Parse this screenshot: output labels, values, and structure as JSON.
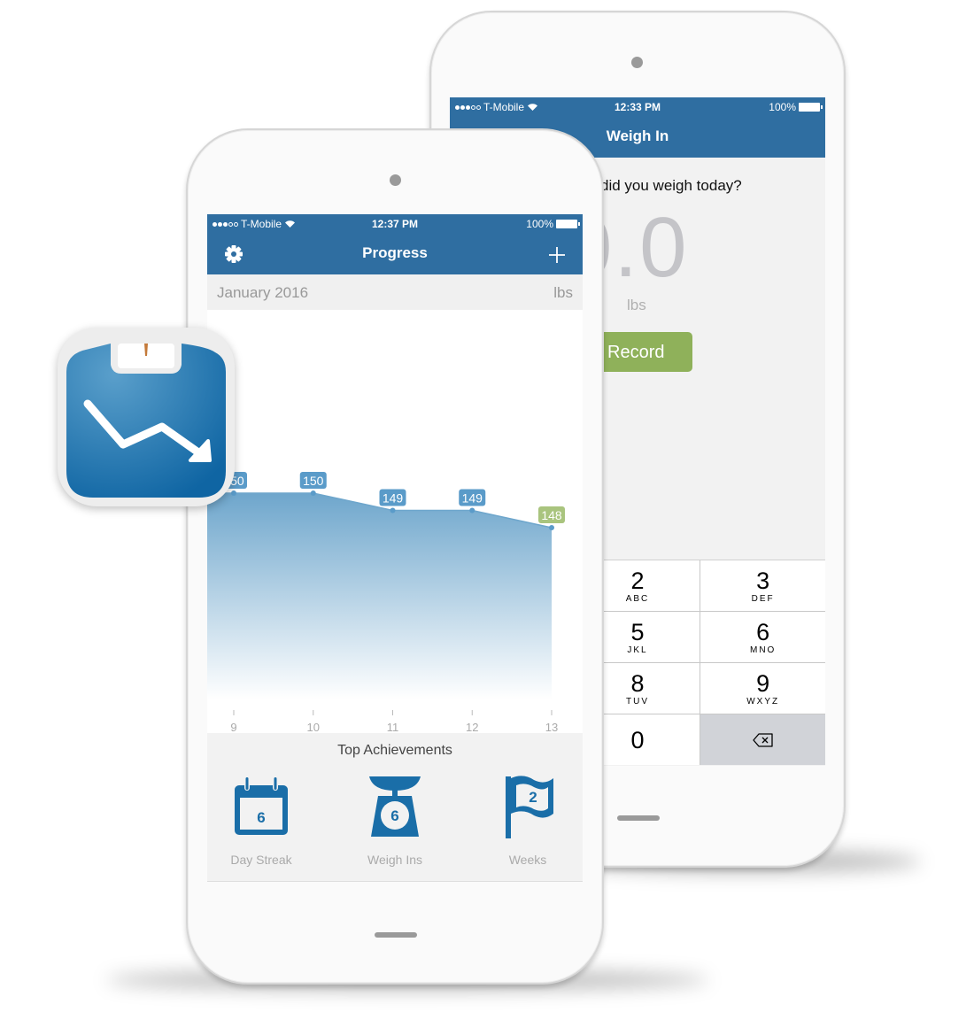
{
  "back_phone": {
    "status": {
      "carrier": "T-Mobile",
      "time": "12:33 PM",
      "battery": "100%"
    },
    "nav_title": "Weigh In",
    "question": "did you weigh today?",
    "value_display": "0.0",
    "unit": "lbs",
    "record_button": "Record",
    "keypad": [
      {
        "num": "2",
        "letters": "ABC"
      },
      {
        "num": "3",
        "letters": "DEF"
      },
      {
        "num": "5",
        "letters": "JKL"
      },
      {
        "num": "6",
        "letters": "MNO"
      },
      {
        "num": "8",
        "letters": "TUV"
      },
      {
        "num": "9",
        "letters": "WXYZ"
      },
      {
        "num": "0",
        "letters": ""
      }
    ]
  },
  "front_phone": {
    "status": {
      "carrier": "T-Mobile",
      "time": "12:37 PM",
      "battery": "100%"
    },
    "nav_title": "Progress",
    "month": "January 2016",
    "unit": "lbs",
    "achievements_title": "Top Achievements",
    "achievements": [
      {
        "icon": "calendar-icon",
        "value": "6",
        "label": "Day Streak"
      },
      {
        "icon": "scale-icon",
        "value": "6",
        "label": "Weigh Ins"
      },
      {
        "icon": "flag-icon",
        "value": "2",
        "label": "Weeks"
      }
    ]
  },
  "colors": {
    "brand_blue": "#2f6ea1",
    "chart_blue": "#5a9bc9",
    "latest_green": "#a9c47e",
    "record_green": "#8fb15a",
    "achievement_blue": "#1a6ea8"
  },
  "chart_data": {
    "type": "area",
    "title": "",
    "xlabel": "",
    "ylabel": "lbs",
    "x": [
      9,
      10,
      11,
      12,
      13
    ],
    "values": [
      150,
      150,
      149,
      149,
      148
    ],
    "data_labels": [
      "150",
      "150",
      "149",
      "149",
      "148"
    ],
    "highlight_last": true,
    "grid": false
  }
}
